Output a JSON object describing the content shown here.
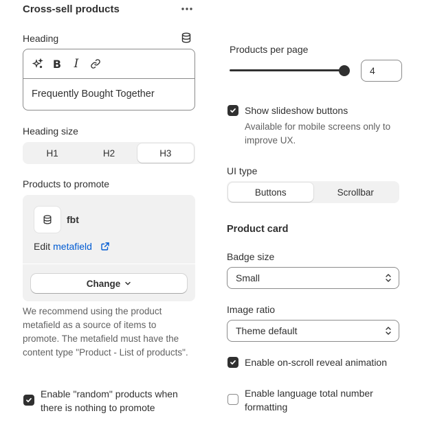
{
  "section": {
    "title": "Cross-sell products",
    "more_icon": "horizontal-dots-icon"
  },
  "heading": {
    "label": "Heading",
    "source_icon": "database-icon",
    "toolbar": {
      "magic_icon": "sparkle-icon",
      "bold": "B",
      "italic": "I",
      "link_icon": "link-icon"
    },
    "value": "Frequently Bought Together"
  },
  "heading_size": {
    "label": "Heading size",
    "options": [
      "H1",
      "H2",
      "H3"
    ],
    "selected": "H3"
  },
  "products_to_promote": {
    "label": "Products to promote",
    "metafield_icon": "database-icon",
    "metafield_name": "fbt",
    "edit_prefix": "Edit",
    "edit_link": "metafield",
    "external_icon": "external-link-icon",
    "change_button": "Change",
    "change_icon": "chevron-down-icon",
    "help": "We recommend using the product metafield as a source of items to promote. The metafield must have the content type \"Product - List of products\"."
  },
  "random_products": {
    "checked": true,
    "label": "Enable \"random\" products when there is nothing to promote"
  },
  "products_per_page": {
    "label": "Products per page",
    "value": "4",
    "slider_fraction": 1.0
  },
  "slideshow": {
    "checked": true,
    "label": "Show slideshow buttons",
    "help": "Available for mobile screens only to improve UX."
  },
  "ui_type": {
    "label": "UI type",
    "options": [
      "Buttons",
      "Scrollbar"
    ],
    "selected": "Buttons"
  },
  "product_card": {
    "title": "Product card",
    "badge_size": {
      "label": "Badge size",
      "value": "Small",
      "icon": "select-arrows-icon"
    },
    "image_ratio": {
      "label": "Image ratio",
      "value": "Theme default",
      "icon": "select-arrows-icon"
    },
    "reveal_animation": {
      "checked": true,
      "label": "Enable on-scroll reveal animation"
    },
    "language_formatting": {
      "checked": false,
      "label": "Enable language total number formatting"
    }
  },
  "colors": {
    "text": "#303030",
    "subdued": "#616161",
    "link": "#005bd3",
    "surface": "#f1f1f1",
    "border": "#8a8a8a"
  }
}
